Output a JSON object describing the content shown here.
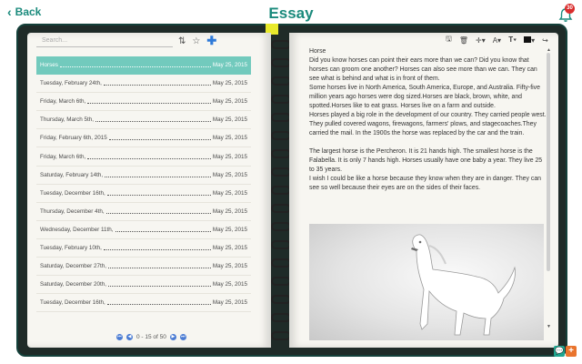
{
  "header": {
    "back_label": "Back",
    "title": "Essay",
    "notification_count": "30",
    "icons": {
      "back": "chevron-left-icon",
      "notification": "bell-icon"
    }
  },
  "colors": {
    "accent": "#1a8a7c",
    "selected_row": "#72cabd",
    "frame": "#1f2b28",
    "page": "#f7f6f1",
    "badge": "#d92c2c"
  },
  "left_page": {
    "search_placeholder": "Search...",
    "tools": {
      "sort": "sort-icon",
      "favorite": "star-icon",
      "add": "plus-icon"
    },
    "entries": [
      {
        "name": "Horses",
        "date": "May 25, 2015",
        "selected": true
      },
      {
        "name": "Tuesday, February 24th,",
        "date": "May 25, 2015"
      },
      {
        "name": "Friday, March 6th,",
        "date": "May 25, 2015"
      },
      {
        "name": "Thursday, March 5th,",
        "date": "May 25, 2015"
      },
      {
        "name": "Friday, February 6th, 2015",
        "date": "May 25, 2015"
      },
      {
        "name": "Friday, March 6th,",
        "date": "May 25, 2015"
      },
      {
        "name": "Saturday, February 14th,",
        "date": "May 25, 2015"
      },
      {
        "name": "Tuesday, December 16th,",
        "date": "May 25, 2015"
      },
      {
        "name": "Thursday, December 4th,",
        "date": "May 25, 2015"
      },
      {
        "name": "Wednesday, December 11th,",
        "date": "May 25, 2015"
      },
      {
        "name": "Tuesday, February 10th,",
        "date": "May 25, 2015"
      },
      {
        "name": "Saturday, December 27th,",
        "date": "May 25, 2015"
      },
      {
        "name": "Saturday, December 20th,",
        "date": "May 25, 2015"
      },
      {
        "name": "Tuesday, December 16th,",
        "date": "May 25, 2015"
      }
    ],
    "pagination": {
      "range": "0 - 15 of 50"
    }
  },
  "right_page": {
    "tools": [
      "save-icon",
      "delete-icon",
      "add-icon",
      "font-icon",
      "font-size-icon",
      "color-icon",
      "share-icon"
    ],
    "heading": "Horse",
    "paragraphs": [
      "Did you know horses can point their ears more than we can? Did you know that horses can groom one another? Horses can also see more than we can. They can see what is behind and what is in front of them.",
      "Some horses live in North America, South America, Europe, and Australia. Fifty-five million years ago horses were dog sized.Horses are black, brown, white, and spotted.Horses like to eat grass. Horses live on a farm and outside.",
      "Horses played a big role in the development of our country. They carried people west. They pulled covered wagons, firewagons, farmers' plows, and stagecoaches.They carried the mail. In the 1900s the horse was replaced by the car and the train.",
      "",
      "The largest horse is the Percheron. It is 21 hands high. The smallest horse is the Falabella. It is only 7 hands high. Horses usually have one baby a year. They live 25 to 35 years.",
      "I wish I could be like a horse because they know when they are in danger. They can see so well because their eyes are on the sides of their faces."
    ],
    "image": "white-horse-image"
  }
}
